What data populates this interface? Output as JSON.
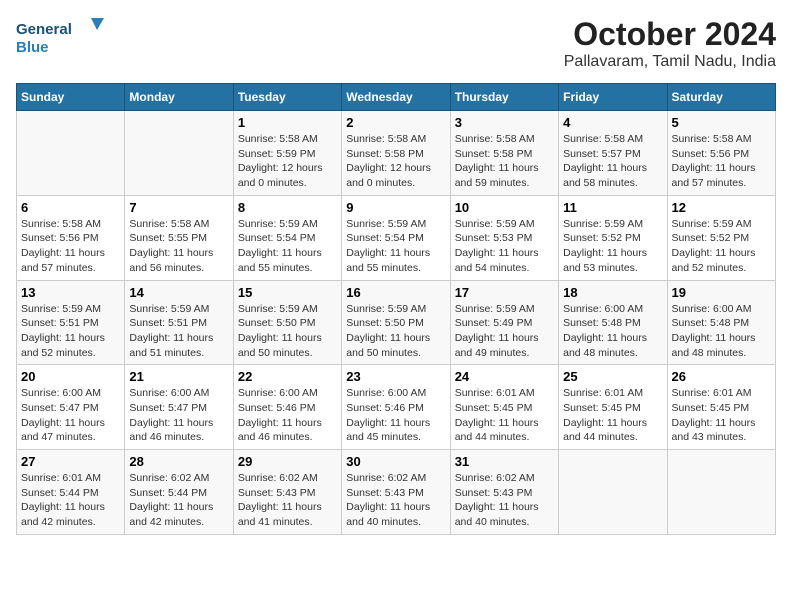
{
  "header": {
    "logo_general": "General",
    "logo_blue": "Blue",
    "month_title": "October 2024",
    "location": "Pallavaram, Tamil Nadu, India"
  },
  "days_of_week": [
    "Sunday",
    "Monday",
    "Tuesday",
    "Wednesday",
    "Thursday",
    "Friday",
    "Saturday"
  ],
  "weeks": [
    [
      {
        "day": "",
        "info": ""
      },
      {
        "day": "",
        "info": ""
      },
      {
        "day": "1",
        "info": "Sunrise: 5:58 AM\nSunset: 5:59 PM\nDaylight: 12 hours\nand 0 minutes."
      },
      {
        "day": "2",
        "info": "Sunrise: 5:58 AM\nSunset: 5:58 PM\nDaylight: 12 hours\nand 0 minutes."
      },
      {
        "day": "3",
        "info": "Sunrise: 5:58 AM\nSunset: 5:58 PM\nDaylight: 11 hours\nand 59 minutes."
      },
      {
        "day": "4",
        "info": "Sunrise: 5:58 AM\nSunset: 5:57 PM\nDaylight: 11 hours\nand 58 minutes."
      },
      {
        "day": "5",
        "info": "Sunrise: 5:58 AM\nSunset: 5:56 PM\nDaylight: 11 hours\nand 57 minutes."
      }
    ],
    [
      {
        "day": "6",
        "info": "Sunrise: 5:58 AM\nSunset: 5:56 PM\nDaylight: 11 hours\nand 57 minutes."
      },
      {
        "day": "7",
        "info": "Sunrise: 5:58 AM\nSunset: 5:55 PM\nDaylight: 11 hours\nand 56 minutes."
      },
      {
        "day": "8",
        "info": "Sunrise: 5:59 AM\nSunset: 5:54 PM\nDaylight: 11 hours\nand 55 minutes."
      },
      {
        "day": "9",
        "info": "Sunrise: 5:59 AM\nSunset: 5:54 PM\nDaylight: 11 hours\nand 55 minutes."
      },
      {
        "day": "10",
        "info": "Sunrise: 5:59 AM\nSunset: 5:53 PM\nDaylight: 11 hours\nand 54 minutes."
      },
      {
        "day": "11",
        "info": "Sunrise: 5:59 AM\nSunset: 5:52 PM\nDaylight: 11 hours\nand 53 minutes."
      },
      {
        "day": "12",
        "info": "Sunrise: 5:59 AM\nSunset: 5:52 PM\nDaylight: 11 hours\nand 52 minutes."
      }
    ],
    [
      {
        "day": "13",
        "info": "Sunrise: 5:59 AM\nSunset: 5:51 PM\nDaylight: 11 hours\nand 52 minutes."
      },
      {
        "day": "14",
        "info": "Sunrise: 5:59 AM\nSunset: 5:51 PM\nDaylight: 11 hours\nand 51 minutes."
      },
      {
        "day": "15",
        "info": "Sunrise: 5:59 AM\nSunset: 5:50 PM\nDaylight: 11 hours\nand 50 minutes."
      },
      {
        "day": "16",
        "info": "Sunrise: 5:59 AM\nSunset: 5:50 PM\nDaylight: 11 hours\nand 50 minutes."
      },
      {
        "day": "17",
        "info": "Sunrise: 5:59 AM\nSunset: 5:49 PM\nDaylight: 11 hours\nand 49 minutes."
      },
      {
        "day": "18",
        "info": "Sunrise: 6:00 AM\nSunset: 5:48 PM\nDaylight: 11 hours\nand 48 minutes."
      },
      {
        "day": "19",
        "info": "Sunrise: 6:00 AM\nSunset: 5:48 PM\nDaylight: 11 hours\nand 48 minutes."
      }
    ],
    [
      {
        "day": "20",
        "info": "Sunrise: 6:00 AM\nSunset: 5:47 PM\nDaylight: 11 hours\nand 47 minutes."
      },
      {
        "day": "21",
        "info": "Sunrise: 6:00 AM\nSunset: 5:47 PM\nDaylight: 11 hours\nand 46 minutes."
      },
      {
        "day": "22",
        "info": "Sunrise: 6:00 AM\nSunset: 5:46 PM\nDaylight: 11 hours\nand 46 minutes."
      },
      {
        "day": "23",
        "info": "Sunrise: 6:00 AM\nSunset: 5:46 PM\nDaylight: 11 hours\nand 45 minutes."
      },
      {
        "day": "24",
        "info": "Sunrise: 6:01 AM\nSunset: 5:45 PM\nDaylight: 11 hours\nand 44 minutes."
      },
      {
        "day": "25",
        "info": "Sunrise: 6:01 AM\nSunset: 5:45 PM\nDaylight: 11 hours\nand 44 minutes."
      },
      {
        "day": "26",
        "info": "Sunrise: 6:01 AM\nSunset: 5:45 PM\nDaylight: 11 hours\nand 43 minutes."
      }
    ],
    [
      {
        "day": "27",
        "info": "Sunrise: 6:01 AM\nSunset: 5:44 PM\nDaylight: 11 hours\nand 42 minutes."
      },
      {
        "day": "28",
        "info": "Sunrise: 6:02 AM\nSunset: 5:44 PM\nDaylight: 11 hours\nand 42 minutes."
      },
      {
        "day": "29",
        "info": "Sunrise: 6:02 AM\nSunset: 5:43 PM\nDaylight: 11 hours\nand 41 minutes."
      },
      {
        "day": "30",
        "info": "Sunrise: 6:02 AM\nSunset: 5:43 PM\nDaylight: 11 hours\nand 40 minutes."
      },
      {
        "day": "31",
        "info": "Sunrise: 6:02 AM\nSunset: 5:43 PM\nDaylight: 11 hours\nand 40 minutes."
      },
      {
        "day": "",
        "info": ""
      },
      {
        "day": "",
        "info": ""
      }
    ]
  ]
}
